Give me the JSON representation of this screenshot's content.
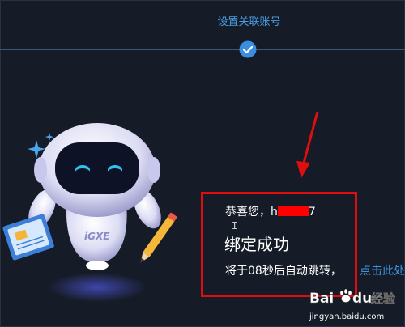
{
  "header": {
    "step_title": "设置关联账号"
  },
  "result": {
    "greeting": "恭喜您，h",
    "greeting_suffix": "7",
    "title": "绑定成功",
    "countdown": "将于08秒后自动跳转，",
    "link": "点击此处"
  },
  "mascot": {
    "badge_text": "iGXE"
  },
  "watermark": {
    "logo_text_1": "Bai",
    "logo_text_2": "du",
    "logo_text_3": "经验",
    "url": "jingyan.baidu.com"
  },
  "colors": {
    "background": "#161c27",
    "accent": "#4a9fe6",
    "link": "#3d94e0",
    "annotation": "#e00e0e"
  }
}
